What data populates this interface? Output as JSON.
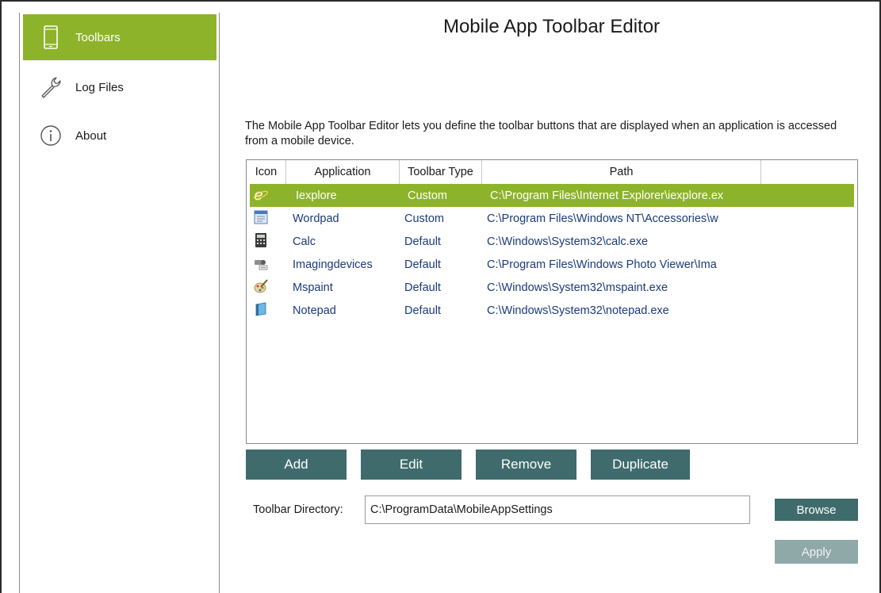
{
  "sidebar": {
    "items": [
      {
        "label": "Toolbars",
        "icon": "phone-icon",
        "active": true
      },
      {
        "label": "Log Files",
        "icon": "wrench-icon",
        "active": false
      },
      {
        "label": "About",
        "icon": "info-icon",
        "active": false
      }
    ]
  },
  "main": {
    "title": "Mobile App Toolbar Editor",
    "description": "The Mobile App Toolbar Editor lets you define the toolbar buttons that are displayed when an application is accessed from a mobile device."
  },
  "table": {
    "columns": [
      "Icon",
      "Application",
      "Toolbar Type",
      "Path"
    ],
    "rows": [
      {
        "icon": "internet-explorer-icon",
        "application": "Iexplore",
        "type": "Custom",
        "path": "C:\\Program Files\\Internet Explorer\\iexplore.ex",
        "selected": true
      },
      {
        "icon": "wordpad-icon",
        "application": "Wordpad",
        "type": "Custom",
        "path": "C:\\Program Files\\Windows NT\\Accessories\\w",
        "selected": false
      },
      {
        "icon": "calculator-icon",
        "application": "Calc",
        "type": "Default",
        "path": "C:\\Windows\\System32\\calc.exe",
        "selected": false
      },
      {
        "icon": "imaging-devices-icon",
        "application": "Imagingdevices",
        "type": "Default",
        "path": "C:\\Program Files\\Windows Photo Viewer\\Ima",
        "selected": false
      },
      {
        "icon": "paint-icon",
        "application": "Mspaint",
        "type": "Default",
        "path": "C:\\Windows\\System32\\mspaint.exe",
        "selected": false
      },
      {
        "icon": "notepad-icon",
        "application": "Notepad",
        "type": "Default",
        "path": "C:\\Windows\\System32\\notepad.exe",
        "selected": false
      }
    ]
  },
  "actions": {
    "add": "Add",
    "edit": "Edit",
    "remove": "Remove",
    "duplicate": "Duplicate"
  },
  "directory": {
    "label": "Toolbar Directory:",
    "value": "C:\\ProgramData\\MobileAppSettings",
    "browse": "Browse",
    "apply": "Apply"
  },
  "colors": {
    "accent": "#8db32a",
    "button": "#3f6b6c",
    "button_disabled": "#8fa8a8",
    "row_text": "#1a3a7a"
  }
}
